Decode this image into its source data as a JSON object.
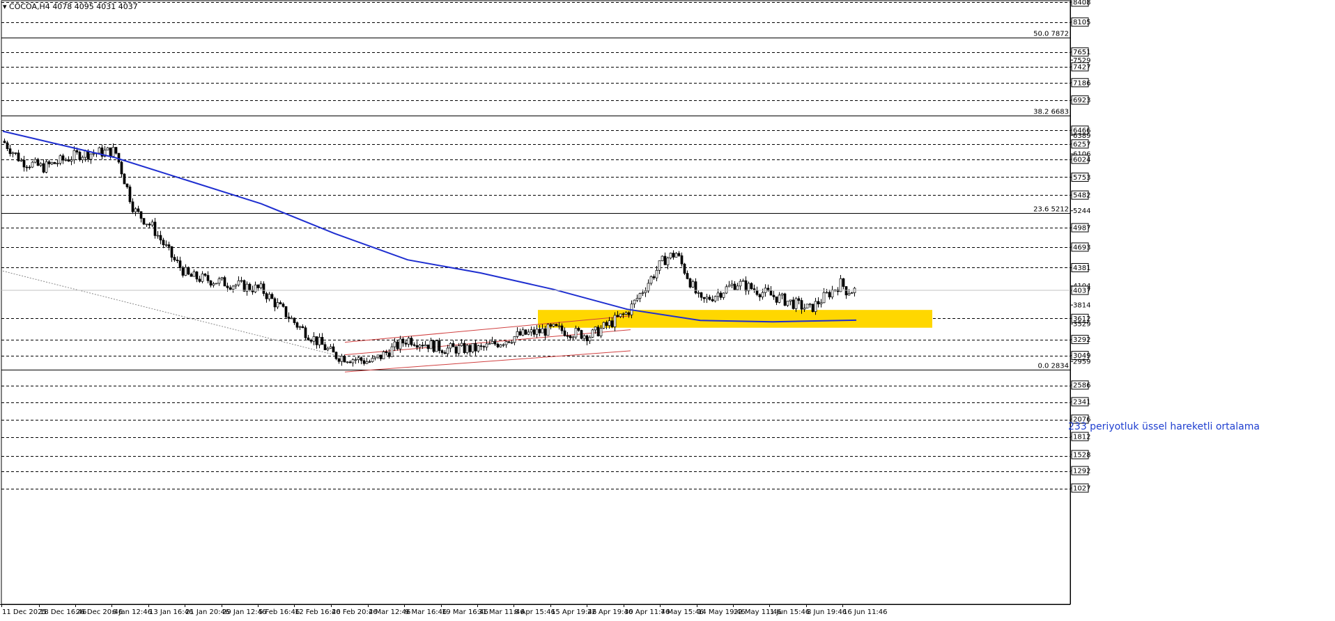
{
  "header": {
    "menu_glyph": "▾",
    "symbol": "COCOA,H4",
    "ohlc": "4078 4095 4031 4037"
  },
  "annotation": {
    "ema_label": "233 periyotluk üssel hareketli ortalama"
  },
  "colors": {
    "candle": "#000000",
    "ema": "#1f2fd0",
    "channel": "#d04040",
    "zone": "#ffd700",
    "grid": "#000000",
    "fib_line": "#000000",
    "trendline": "#888888"
  },
  "chart_data": {
    "type": "candlestick",
    "symbol": "COCOA",
    "timeframe": "H4",
    "ylim": [
      2834,
      8408
    ],
    "price_axis_labels": [
      8408,
      8105,
      7872,
      7651,
      7529,
      7427,
      7186,
      6923,
      6683,
      6466,
      6389,
      6257,
      6106,
      6024,
      5753,
      5482,
      5244,
      5212,
      4987,
      4693,
      4381,
      4104,
      4037,
      3814,
      3612,
      3529,
      3292,
      3049,
      2959,
      2834,
      2586,
      2341,
      2076,
      1812,
      1528,
      1292,
      1027
    ],
    "boxed_levels": [
      8408,
      8105,
      7651,
      7427,
      7186,
      6923,
      6466,
      6257,
      6024,
      5753,
      5482,
      4987,
      4693,
      4381,
      3612,
      3292,
      3049,
      2586,
      2341,
      2076,
      1812,
      1528,
      1292,
      1027
    ],
    "current_price": 4037,
    "fibonacci": [
      {
        "label": "50.0 7872",
        "ratio": 50.0,
        "price": 7872
      },
      {
        "label": "38.2 6683",
        "ratio": 38.2,
        "price": 6683
      },
      {
        "label": "23.6 5212",
        "ratio": 23.6,
        "price": 5212
      },
      {
        "label": "0.0 2834",
        "ratio": 0.0,
        "price": 2834
      }
    ],
    "x_labels": [
      "11 Dec 2025",
      "18 Dec 16:46",
      "26 Dec 20:46",
      "6 Jan 12:46",
      "13 Jan 16:46",
      "21 Jan 20:46",
      "29 Jan 12:46",
      "5 Feb 16:46",
      "12 Feb 16:46",
      "20 Feb 20:46",
      "2 Mar 12:46",
      "9 Mar 16:46",
      "19 Mar 16:46",
      "31 Mar 11:46",
      "8 Apr 15:46",
      "15 Apr 19:46",
      "22 Apr 19:46",
      "30 Apr 11:46",
      "7 May 15:46",
      "14 May 19:46",
      "22 May 11:46",
      "1 Jun 15:46",
      "8 Jun 19:46",
      "16 Jun 11:46"
    ],
    "close_path": [
      {
        "date": "11 Dec 2025",
        "close": 6300
      },
      {
        "date": "15 Dec",
        "close": 6000
      },
      {
        "date": "18 Dec 16:46",
        "close": 5900
      },
      {
        "date": "26 Dec 20:46",
        "close": 6100
      },
      {
        "date": "6 Jan 12:46",
        "close": 6150
      },
      {
        "date": "9 Jan",
        "close": 5250
      },
      {
        "date": "13 Jan 16:46",
        "close": 5000
      },
      {
        "date": "16 Jan",
        "close": 4500
      },
      {
        "date": "21 Jan 20:46",
        "close": 4250
      },
      {
        "date": "29 Jan 12:46",
        "close": 4150
      },
      {
        "date": "5 Feb 16:46",
        "close": 4050
      },
      {
        "date": "12 Feb 16:46",
        "close": 3500
      },
      {
        "date": "20 Feb 20:46",
        "close": 3050
      },
      {
        "date": "2 Mar 12:46",
        "close": 2950
      },
      {
        "date": "9 Mar 16:46",
        "close": 3300
      },
      {
        "date": "19 Mar 16:46",
        "close": 3150
      },
      {
        "date": "31 Mar 11:46",
        "close": 3150
      },
      {
        "date": "8 Apr 15:46",
        "close": 3350
      },
      {
        "date": "15 Apr 19:46",
        "close": 3450
      },
      {
        "date": "22 Apr 19:46",
        "close": 3350
      },
      {
        "date": "30 Apr 11:46",
        "close": 3700
      },
      {
        "date": "7 May 15:46",
        "close": 4500
      },
      {
        "date": "10 May",
        "close": 4600
      },
      {
        "date": "14 May 19:46",
        "close": 3850
      },
      {
        "date": "22 May 11:46",
        "close": 4150
      },
      {
        "date": "1 Jun 15:46",
        "close": 3950
      },
      {
        "date": "8 Jun 19:46",
        "close": 3750
      },
      {
        "date": "12 Jun",
        "close": 4150
      },
      {
        "date": "16 Jun 11:46",
        "close": 4037
      }
    ],
    "ema_233": {
      "label": "233 periyotluk üssel hareketli ortalama",
      "points": [
        {
          "date": "11 Dec 2025",
          "value": 6450
        },
        {
          "date": "6 Jan 12:46",
          "value": 6050
        },
        {
          "date": "21 Jan 20:46",
          "value": 5700
        },
        {
          "date": "5 Feb 16:46",
          "value": 5350
        },
        {
          "date": "20 Feb 20:46",
          "value": 4900
        },
        {
          "date": "9 Mar 16:46",
          "value": 4500
        },
        {
          "date": "31 Mar 11:46",
          "value": 4300
        },
        {
          "date": "15 Apr 19:46",
          "value": 4050
        },
        {
          "date": "30 Apr 11:46",
          "value": 3750
        },
        {
          "date": "14 May 19:46",
          "value": 3580
        },
        {
          "date": "1 Jun 15:46",
          "value": 3560
        },
        {
          "date": "16 Jun 11:46",
          "value": 3585
        }
      ]
    },
    "support_zone": {
      "from_date": "8 Apr 15:46",
      "to_date": "16 Jun 11:46",
      "price_low": 3470,
      "price_high": 3740
    },
    "channel": {
      "start_date": "20 Feb 20:46",
      "end_date": "30 Apr 11:46",
      "upper": [
        3250,
        3650
      ],
      "middle": [
        3060,
        3440
      ],
      "lower": [
        2800,
        3120
      ]
    },
    "long_trendline": {
      "start_date": "11 Dec 2025",
      "start_price": 4330,
      "end_date": "20 Feb 20:46",
      "end_price": 3020
    }
  }
}
